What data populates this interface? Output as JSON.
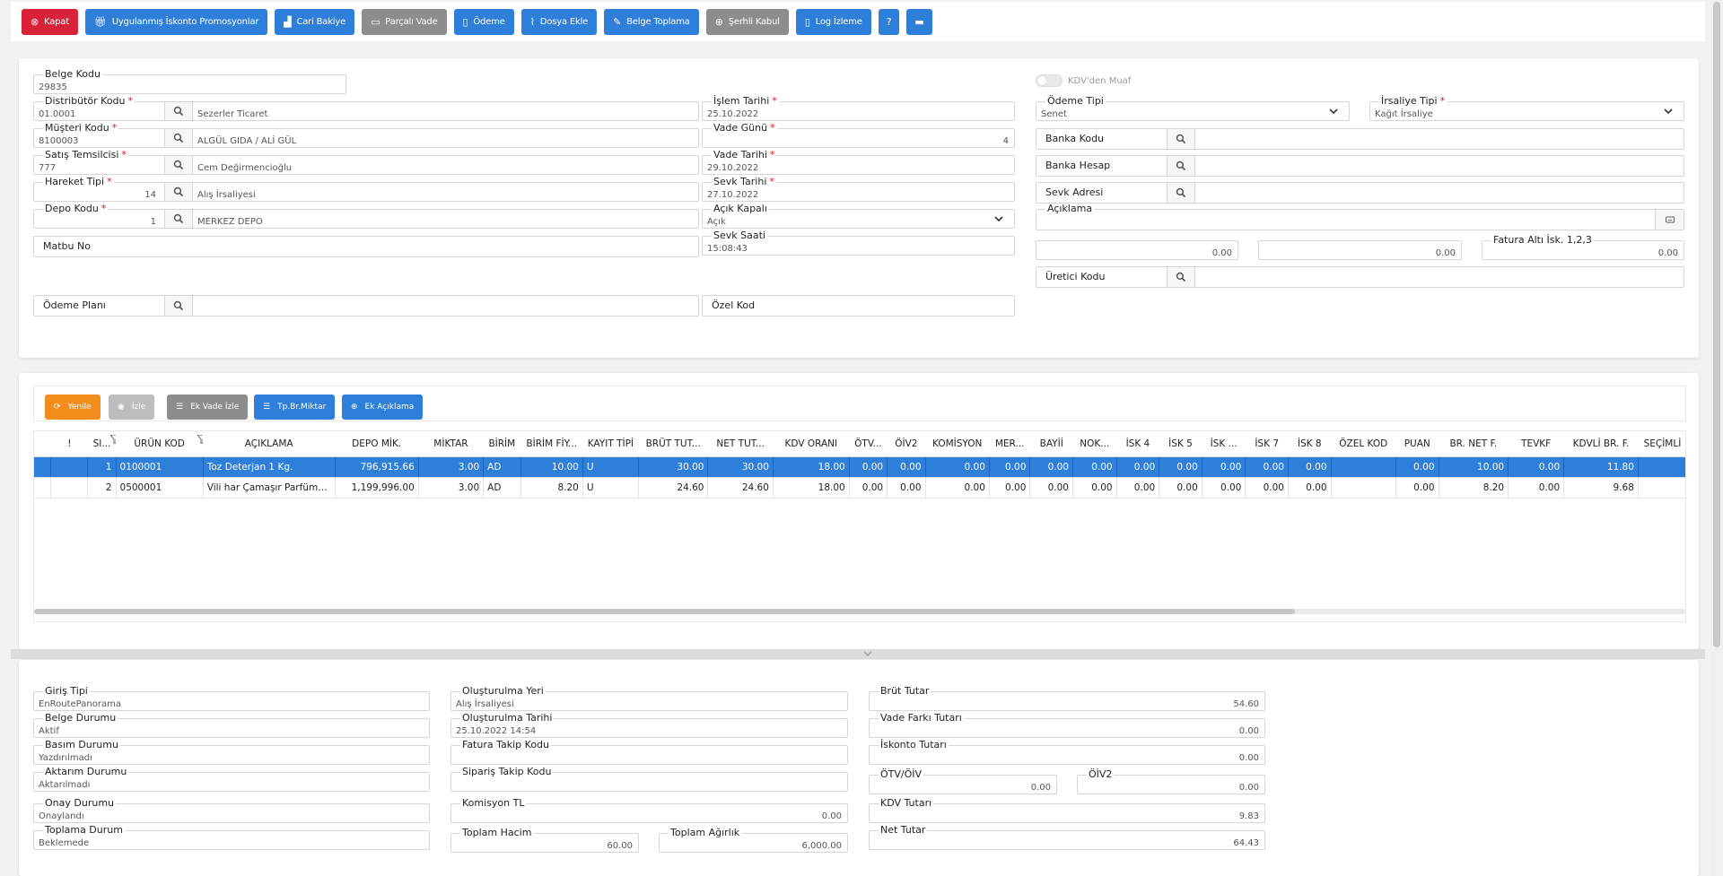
{
  "toolbar": {
    "close": "Kapat",
    "promos": "Uygulanmış İskonto Promosyonlar",
    "balance": "Cari Bakiye",
    "partial": "Parçalı Vade",
    "payment": "Ödeme",
    "attach": "Dosya Ekle",
    "collect": "Belge Toplama",
    "conditional": "Şerhli Kabul",
    "log": "Log İzleme"
  },
  "form": {
    "belge_kodu": {
      "label": "Belge Kodu",
      "value": "29835"
    },
    "distributor": {
      "label": "Distribütör Kodu",
      "value": "01.0001",
      "desc": "Sezerler Ticaret"
    },
    "musteri": {
      "label": "Müşteri Kodu",
      "value": "8100003",
      "desc": "ALGÜL GIDA / ALİ GÜL"
    },
    "satis": {
      "label": "Satış Temsilcisi",
      "value": "777",
      "desc": "Cem Değirmencioğlu"
    },
    "hareket": {
      "label": "Hareket Tipi",
      "value": "14",
      "desc": "Alış İrsaliyesi"
    },
    "depo": {
      "label": "Depo Kodu",
      "value": "1",
      "desc": "MERKEZ DEPO"
    },
    "matbu": {
      "label": "Matbu No",
      "value": ""
    },
    "odeme_plani": {
      "label": "Ödeme Planı",
      "value": ""
    },
    "islem_tarihi": {
      "label": "İşlem Tarihi",
      "value": "25.10.2022"
    },
    "vade_gunu": {
      "label": "Vade Günü",
      "value": "4"
    },
    "vade_tarihi": {
      "label": "Vade Tarihi",
      "value": "29.10.2022"
    },
    "sevk_tarihi": {
      "label": "Sevk Tarihi",
      "value": "27.10.2022"
    },
    "acik_kapali": {
      "label": "Açık Kapalı",
      "value": "Açık"
    },
    "sevk_saati": {
      "label": "Sevk Saati",
      "value": "15:08:43"
    },
    "ozel_kod": {
      "label": "Özel Kod",
      "value": ""
    },
    "kdv_muaf": {
      "label": "KDV'den Muaf"
    },
    "odeme_tipi": {
      "label": "Ödeme Tipi",
      "value": "Senet"
    },
    "irsaliye_tipi": {
      "label": "İrsaliye Tipi",
      "value": "Kağıt İrsaliye"
    },
    "banka_kodu": {
      "label": "Banka Kodu"
    },
    "banka_hesap": {
      "label": "Banka Hesap"
    },
    "sevk_adresi": {
      "label": "Sevk Adresi"
    },
    "aciklama": {
      "label": "Açıklama"
    },
    "isk1": "0.00",
    "isk2": "0.00",
    "fatura_alti": {
      "label": "Fatura Altı İsk. 1,2,3",
      "value": "0.00"
    },
    "uretici": {
      "label": "Üretici Kodu"
    }
  },
  "grid_toolbar": {
    "refresh": "Yenile",
    "watch": "İzle",
    "ek_vade": "Ek Vade İzle",
    "tp_br": "Tp.Br.Miktar",
    "ek_aciklama": "Ek Açıklama"
  },
  "grid": {
    "columns": [
      "!",
      "SI...",
      "ÜRÜN KOD",
      "AÇIKLAMA",
      "DEPO MİK.",
      "MİKTAR",
      "BİRİM",
      "BİRİM FİY...",
      "KAYIT TİPİ",
      "BRÜT TUT...",
      "NET TUT...",
      "KDV ORANI",
      "ÖTV...",
      "ÖİV2",
      "KOMİSYON",
      "MER...",
      "BAYİİ",
      "NOK...",
      "İSK 4",
      "İSK 5",
      "İSK ...",
      "İSK 7",
      "İSK 8",
      "ÖZEL KOD",
      "PUAN",
      "BR. NET F.",
      "TEVKF",
      "KDVLİ BR. F.",
      "SEÇİMLİ"
    ],
    "rows": [
      [
        "",
        "1",
        "0100001",
        "Toz Deterjan 1 Kg.",
        "796,915.66",
        "3.00",
        "AD",
        "10.00",
        "U",
        "30.00",
        "30.00",
        "18.00",
        "0.00",
        "0.00",
        "0.00",
        "0.00",
        "0.00",
        "0.00",
        "0.00",
        "0.00",
        "0.00",
        "0.00",
        "0.00",
        "",
        "0.00",
        "10.00",
        "0.00",
        "11.80",
        ""
      ],
      [
        "",
        "2",
        "0500001",
        "Vili har Çamaşır Parfümü ...",
        "1,199,996.00",
        "3.00",
        "AD",
        "8.20",
        "U",
        "24.60",
        "24.60",
        "18.00",
        "0.00",
        "0.00",
        "0.00",
        "0.00",
        "0.00",
        "0.00",
        "0.00",
        "0.00",
        "0.00",
        "0.00",
        "0.00",
        "",
        "0.00",
        "8.20",
        "0.00",
        "9.68",
        ""
      ]
    ]
  },
  "footer": {
    "giris_tipi": {
      "label": "Giriş Tipi",
      "value": "EnRoutePanorama"
    },
    "belge_durumu": {
      "label": "Belge Durumu",
      "value": "Aktif"
    },
    "basim_durumu": {
      "label": "Basım Durumu",
      "value": "Yazdırılmadı"
    },
    "aktarim_durumu": {
      "label": "Aktarım Durumu",
      "value": "Aktarılmadı"
    },
    "onay_durumu": {
      "label": "Onay Durumu",
      "value": "Onaylandı"
    },
    "toplama_durum": {
      "label": "Toplama Durum",
      "value": "Beklemede"
    },
    "olusturma_yeri": {
      "label": "Oluşturulma Yeri",
      "value": "Alış İrsaliyesi"
    },
    "olusturma_tarihi": {
      "label": "Oluşturulma Tarihi",
      "value": "25.10.2022 14:54"
    },
    "fatura_takip": {
      "label": "Fatura Takip Kodu",
      "value": ""
    },
    "siparis_takip": {
      "label": "Sipariş Takip Kodu",
      "value": ""
    },
    "komisyon": {
      "label": "Komisyon TL",
      "value": "0.00"
    },
    "toplam_hacim": {
      "label": "Toplam Hacim",
      "value": "60.00"
    },
    "toplam_agirlik": {
      "label": "Toplam Ağırlık",
      "value": "6,000.00"
    },
    "brut_tutar": {
      "label": "Brüt Tutar",
      "value": "54.60"
    },
    "vade_farki": {
      "label": "Vade Farkı Tutarı",
      "value": "0.00"
    },
    "iskonto": {
      "label": "İskonto Tutarı",
      "value": "0.00"
    },
    "otv": {
      "label": "ÖTV/ÖİV",
      "value": "0.00"
    },
    "oiv2": {
      "label": "ÖİV2",
      "value": "0.00"
    },
    "kdv": {
      "label": "KDV Tutarı",
      "value": "9.83"
    },
    "net": {
      "label": "Net Tutar",
      "value": "64.43"
    }
  }
}
